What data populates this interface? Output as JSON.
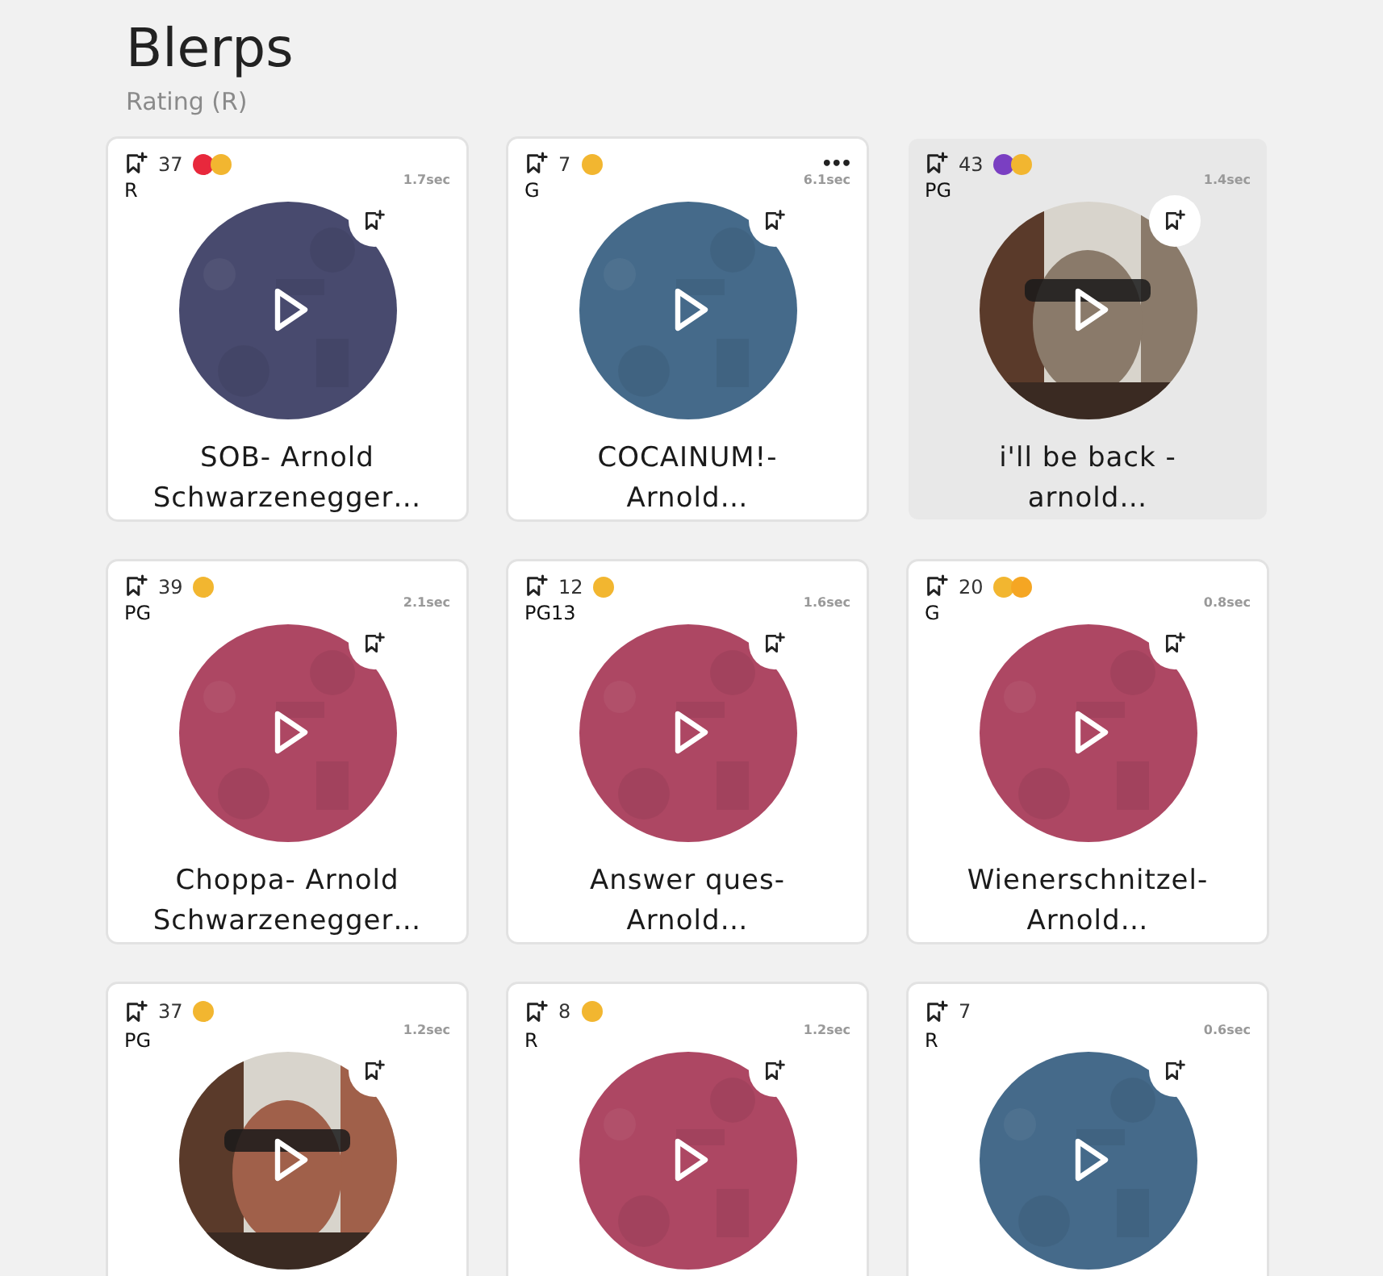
{
  "header": {
    "title": "Blerps",
    "subtitle": "Rating (R)"
  },
  "cards": [
    {
      "saves": "37",
      "reactions": [
        {
          "color": "#e8283c"
        },
        {
          "color": "#f2b630"
        }
      ],
      "rating": "R",
      "duration": "1.7sec",
      "thumbnail": {
        "kind": "pattern",
        "color": "#484a6e"
      },
      "title": "SOB- Arnold Schwarzenegger…",
      "highlighted": false
    },
    {
      "saves": "7",
      "reactions": [
        {
          "color": "#f2b630"
        }
      ],
      "rating": "G",
      "duration": "6.1sec",
      "thumbnail": {
        "kind": "pattern",
        "color": "#456a8a"
      },
      "title": "COCAINUM!- Arnold…",
      "highlighted": false,
      "menu_label": "•••"
    },
    {
      "saves": "43",
      "reactions": [
        {
          "color": "#7a3fc2"
        },
        {
          "color": "#f2b630"
        }
      ],
      "rating": "PG",
      "duration": "1.4sec",
      "thumbnail": {
        "kind": "picture",
        "color": "#8a7a6a"
      },
      "title": "i'll be back - arnold…",
      "highlighted": true
    },
    {
      "saves": "39",
      "reactions": [
        {
          "color": "#f2b630"
        }
      ],
      "rating": "PG",
      "duration": "2.1sec",
      "thumbnail": {
        "kind": "pattern",
        "color": "#ad4763"
      },
      "title": "Choppa- Arnold Schwarzenegger…",
      "highlighted": false
    },
    {
      "saves": "12",
      "reactions": [
        {
          "color": "#f2b630"
        }
      ],
      "rating": "PG13",
      "duration": "1.6sec",
      "thumbnail": {
        "kind": "pattern",
        "color": "#ad4763"
      },
      "title": "Answer ques- Arnold…",
      "highlighted": false
    },
    {
      "saves": "20",
      "reactions": [
        {
          "color": "#f2b630"
        },
        {
          "color": "#f5a623"
        }
      ],
      "rating": "G",
      "duration": "0.8sec",
      "thumbnail": {
        "kind": "pattern",
        "color": "#ad4763"
      },
      "title": "Wienerschnitzel- Arnold…",
      "highlighted": false
    },
    {
      "saves": "37",
      "reactions": [
        {
          "color": "#f2b630"
        }
      ],
      "rating": "PG",
      "duration": "1.2sec",
      "thumbnail": {
        "kind": "picture",
        "color": "#a0604a"
      },
      "highlighted": false
    },
    {
      "saves": "8",
      "reactions": [
        {
          "color": "#f2b630"
        }
      ],
      "rating": "R",
      "duration": "1.2sec",
      "thumbnail": {
        "kind": "pattern",
        "color": "#ad4763"
      },
      "highlighted": false
    },
    {
      "saves": "7",
      "rating": "R",
      "duration": "0.6sec",
      "thumbnail": {
        "kind": "pattern",
        "color": "#456a8a"
      },
      "highlighted": false
    }
  ]
}
